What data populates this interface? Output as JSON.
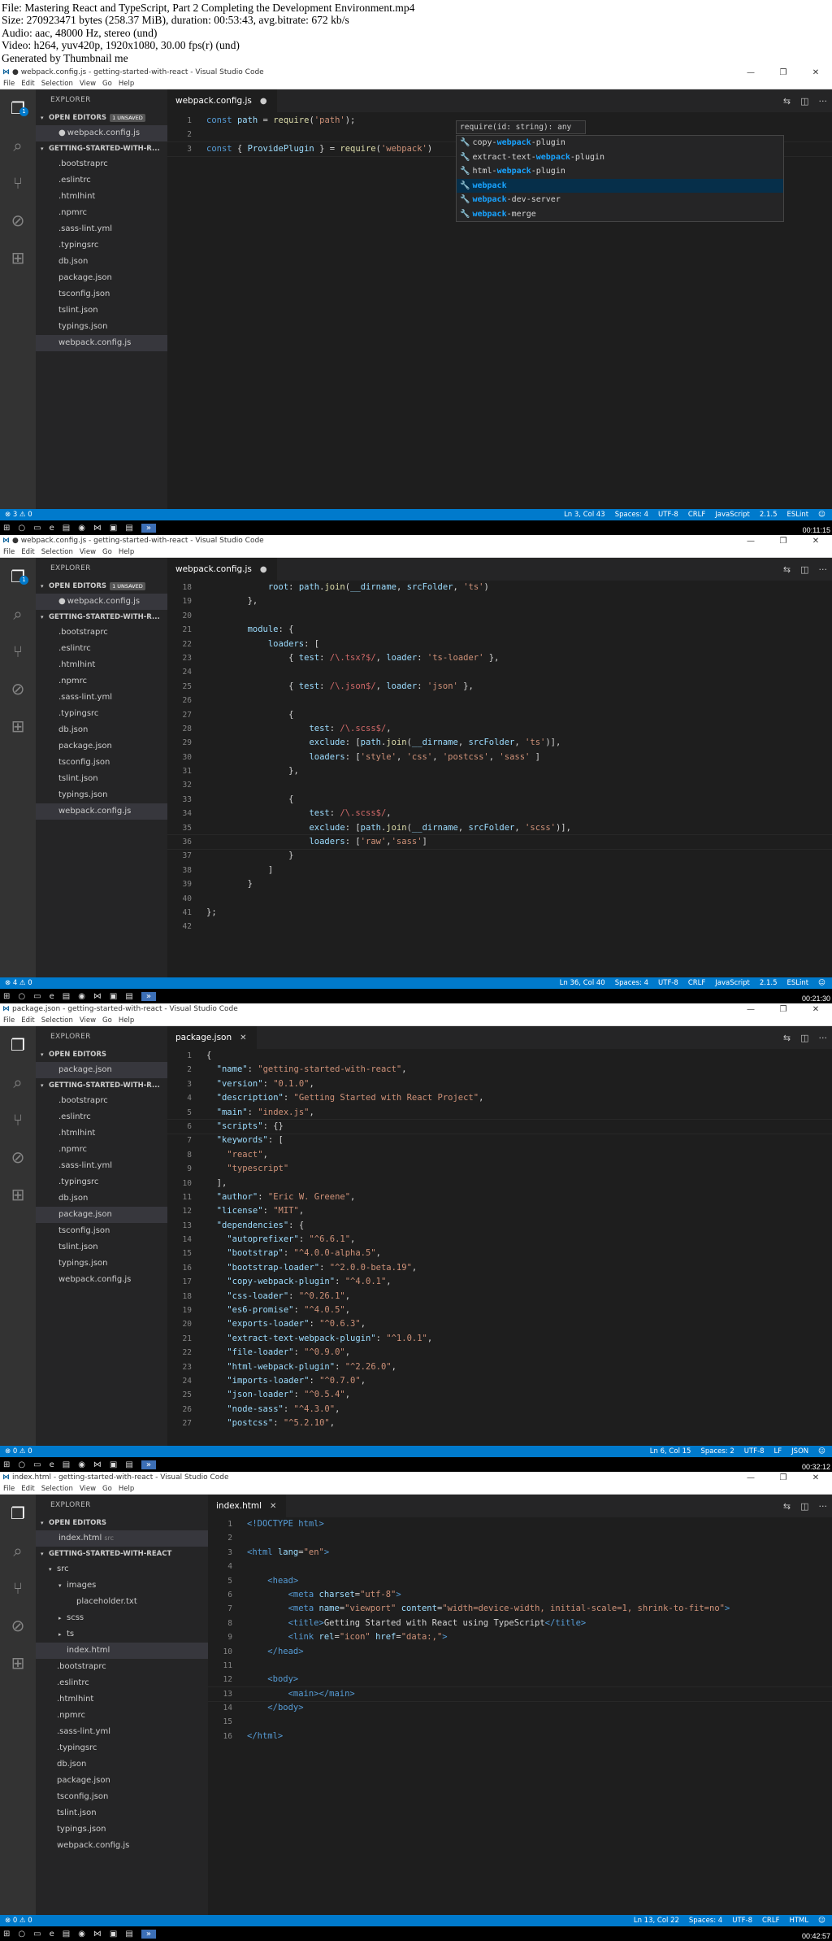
{
  "header": {
    "lines": [
      "File: Mastering React and TypeScript, Part 2 Completing the Development Environment.mp4",
      "Size: 270923471 bytes (258.37 MiB), duration: 00:53:43, avg.bitrate: 672 kb/s",
      "Audio: aac, 48000 Hz, stereo (und)",
      "Video: h264, yuv420p, 1920x1080, 30.00 fps(r) (und)",
      "Generated by Thumbnail me"
    ]
  },
  "common": {
    "menu": [
      "File",
      "Edit",
      "Selection",
      "View",
      "Go",
      "Help"
    ],
    "win_controls": [
      "—",
      "❐",
      "✕"
    ],
    "explorer_title": "EXPLORER",
    "open_editors": "OPEN EDITORS",
    "taskbar_icons": [
      "⊞",
      "○",
      "▭",
      "e",
      "▤",
      "◉",
      "⋈",
      "▣",
      "▤",
      "»"
    ]
  },
  "frames": [
    {
      "title": "● webpack.config.js - getting-started-with-react - Visual Studio Code",
      "badge": "1 UNSAVED",
      "open_file": "webpack.config.js",
      "project": "GETTING-STARTED-WITH-R...",
      "files": [
        ".bootstraprc",
        ".eslintrc",
        ".htmlhint",
        ".npmrc",
        ".sass-lint.yml",
        ".typingsrc",
        "db.json",
        "package.json",
        "tsconfig.json",
        "tslint.json",
        "typings.json",
        "webpack.config.js"
      ],
      "tab": "webpack.config.js",
      "status_left": "⊗ 3 ⚠ 0",
      "status_right": [
        "Ln 3, Col 43",
        "Spaces: 4",
        "UTF-8",
        "CRLF",
        "JavaScript",
        "2.1.5",
        "ESLint",
        "☺"
      ],
      "timestamp": "00:11:15",
      "suggest_sig": "require(id: string): any",
      "suggestions": [
        {
          "pre": "copy-",
          "match": "webpack",
          "post": "-plugin"
        },
        {
          "pre": "extract-text-",
          "match": "webpack",
          "post": "-plugin"
        },
        {
          "pre": "html-",
          "match": "webpack",
          "post": "-plugin"
        },
        {
          "pre": "",
          "match": "webpack",
          "post": ""
        },
        {
          "pre": "",
          "match": "webpack",
          "post": "-dev-server"
        },
        {
          "pre": "",
          "match": "webpack",
          "post": "-merge"
        }
      ]
    },
    {
      "title": "● webpack.config.js - getting-started-with-react - Visual Studio Code",
      "badge": "1 UNSAVED",
      "open_file": "webpack.config.js",
      "project": "GETTING-STARTED-WITH-R...",
      "files": [
        ".bootstraprc",
        ".eslintrc",
        ".htmlhint",
        ".npmrc",
        ".sass-lint.yml",
        ".typingsrc",
        "db.json",
        "package.json",
        "tsconfig.json",
        "tslint.json",
        "typings.json",
        "webpack.config.js"
      ],
      "tab": "webpack.config.js",
      "status_left": "⊗ 4 ⚠ 0",
      "status_right": [
        "Ln 36, Col 40",
        "Spaces: 4",
        "UTF-8",
        "CRLF",
        "JavaScript",
        "2.1.5",
        "ESLint",
        "☺"
      ],
      "timestamp": "00:21:30"
    },
    {
      "title": "package.json - getting-started-with-react - Visual Studio Code",
      "open_file": "package.json",
      "project": "GETTING-STARTED-WITH-R...",
      "files": [
        ".bootstraprc",
        ".eslintrc",
        ".htmlhint",
        ".npmrc",
        ".sass-lint.yml",
        ".typingsrc",
        "db.json",
        "package.json",
        "tsconfig.json",
        "tslint.json",
        "typings.json",
        "webpack.config.js"
      ],
      "tab": "package.json",
      "status_left": "⊗ 0 ⚠ 0",
      "status_right": [
        "Ln 6, Col 15",
        "Spaces: 2",
        "UTF-8",
        "LF",
        "JSON",
        "☺"
      ],
      "timestamp": "00:32:12"
    },
    {
      "title": "index.html - getting-started-with-react - Visual Studio Code",
      "open_file": "index.html",
      "open_file_hint": "src",
      "project": "GETTING-STARTED-WITH-REACT",
      "tree": [
        {
          "label": "src",
          "depth": 0,
          "chev": "▾"
        },
        {
          "label": "images",
          "depth": 1,
          "chev": "▾"
        },
        {
          "label": "placeholder.txt",
          "depth": 2,
          "chev": ""
        },
        {
          "label": "scss",
          "depth": 1,
          "chev": "▸"
        },
        {
          "label": "ts",
          "depth": 1,
          "chev": "▸"
        },
        {
          "label": "index.html",
          "depth": 1,
          "chev": ""
        },
        {
          "label": ".bootstraprc",
          "depth": 0,
          "chev": ""
        },
        {
          "label": ".eslintrc",
          "depth": 0,
          "chev": ""
        },
        {
          "label": ".htmlhint",
          "depth": 0,
          "chev": ""
        },
        {
          "label": ".npmrc",
          "depth": 0,
          "chev": ""
        },
        {
          "label": ".sass-lint.yml",
          "depth": 0,
          "chev": ""
        },
        {
          "label": ".typingsrc",
          "depth": 0,
          "chev": ""
        },
        {
          "label": "db.json",
          "depth": 0,
          "chev": ""
        },
        {
          "label": "package.json",
          "depth": 0,
          "chev": ""
        },
        {
          "label": "tsconfig.json",
          "depth": 0,
          "chev": ""
        },
        {
          "label": "tslint.json",
          "depth": 0,
          "chev": ""
        },
        {
          "label": "typings.json",
          "depth": 0,
          "chev": ""
        },
        {
          "label": "webpack.config.js",
          "depth": 0,
          "chev": ""
        }
      ],
      "tab": "index.html",
      "status_left": "⊗ 0 ⚠ 0",
      "status_right": [
        "Ln 13, Col 22",
        "Spaces: 4",
        "UTF-8",
        "CRLF",
        "HTML",
        "☺"
      ],
      "timestamp": "00:42:57"
    }
  ]
}
